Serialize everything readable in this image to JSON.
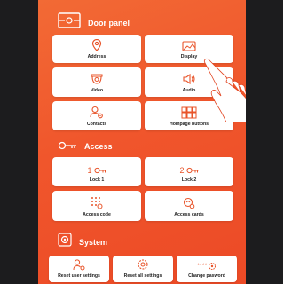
{
  "colors": {
    "accent": "#f0562c",
    "icon": "#e8542a",
    "bezel": "#1c1c1e",
    "card": "#ffffff",
    "label": "#222222"
  },
  "door_panel": {
    "title": "Door panel",
    "icon": "door-panel-icon",
    "items": [
      {
        "label": "Address",
        "icon": "location-pin-icon"
      },
      {
        "label": "Display",
        "icon": "image-icon"
      },
      {
        "label": "Video",
        "icon": "camera-icon"
      },
      {
        "label": "Audio",
        "icon": "speaker-icon"
      },
      {
        "label": "Contacts",
        "icon": "contacts-gear-icon"
      },
      {
        "label": "Hompage buttons",
        "icon": "grid-buttons-icon"
      }
    ]
  },
  "access": {
    "title": "Access",
    "icon": "key-icon",
    "items": [
      {
        "label": "Lock 1",
        "prefix": "1",
        "icon": "key-icon"
      },
      {
        "label": "Lock 2",
        "prefix": "2",
        "icon": "key-icon"
      },
      {
        "label": "Access code",
        "icon": "keypad-icon"
      },
      {
        "label": "Access cards",
        "icon": "card-reader-icon"
      }
    ]
  },
  "system": {
    "title": "System",
    "icon": "gear-icon",
    "items": [
      {
        "label": "Reset user settings",
        "icon": "user-reset-icon"
      },
      {
        "label": "Reset all settings",
        "icon": "gear-reset-icon"
      },
      {
        "label": "Change pasword",
        "icon": "password-gear-icon",
        "mask": "****"
      }
    ]
  }
}
